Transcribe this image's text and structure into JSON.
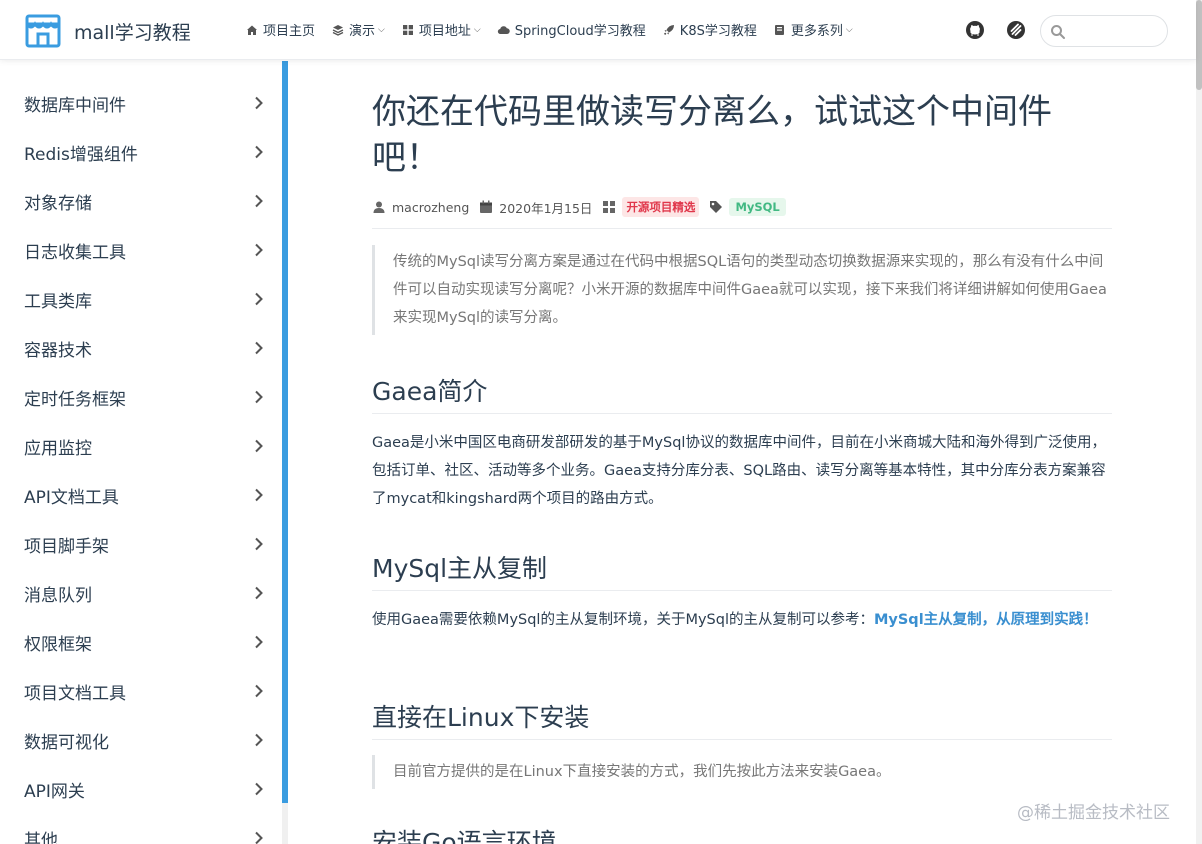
{
  "navbar": {
    "site_name": "mall学习教程",
    "items": [
      {
        "label": "项目主页",
        "icon": "home-icon",
        "caret": false
      },
      {
        "label": "演示",
        "icon": "layers-icon",
        "caret": true
      },
      {
        "label": "项目地址",
        "icon": "grid-icon",
        "caret": true
      },
      {
        "label": "SpringCloud学习教程",
        "icon": "cloud-icon",
        "caret": false
      },
      {
        "label": "K8S学习教程",
        "icon": "rocket-icon",
        "caret": false
      },
      {
        "label": "更多系列",
        "icon": "book-icon",
        "caret": true
      }
    ],
    "search_placeholder": ""
  },
  "sidebar": {
    "items": [
      {
        "label": "数据库中间件"
      },
      {
        "label": "Redis增强组件"
      },
      {
        "label": "对象存储"
      },
      {
        "label": "日志收集工具"
      },
      {
        "label": "工具类库"
      },
      {
        "label": "容器技术"
      },
      {
        "label": "定时任务框架"
      },
      {
        "label": "应用监控"
      },
      {
        "label": "API文档工具"
      },
      {
        "label": "项目脚手架"
      },
      {
        "label": "消息队列"
      },
      {
        "label": "权限框架"
      },
      {
        "label": "项目文档工具"
      },
      {
        "label": "数据可视化"
      },
      {
        "label": "API网关"
      },
      {
        "label": "其他"
      }
    ]
  },
  "article": {
    "title": "你还在代码里做读写分离么，试试这个中间件吧！",
    "author": "macrozheng",
    "date": "2020年1月15日",
    "category": "开源项目精选",
    "tag": "MySQL",
    "intro": "传统的MySql读写分离方案是通过在代码中根据SQL语句的类型动态切换数据源来实现的，那么有没有什么中间件可以自动实现读写分离呢？小米开源的数据库中间件Gaea就可以实现，接下来我们将详细讲解如何使用Gaea来实现MySql的读写分离。",
    "section1_title": "Gaea简介",
    "section1_text": "Gaea是小米中国区电商研发部研发的基于MySql协议的数据库中间件，目前在小米商城大陆和海外得到广泛使用，包括订单、社区、活动等多个业务。Gaea支持分库分表、SQL路由、读写分离等基本特性，其中分库分表方案兼容了mycat和kingshard两个项目的路由方式。",
    "section2_title": "MySql主从复制",
    "section2_text": "使用Gaea需要依赖MySql的主从复制环境，关于MySql的主从复制可以参考：",
    "section2_link": "MySql主从复制，从原理到实践！",
    "section3_title": "直接在Linux下安装",
    "section3_quote": "目前官方提供的是在Linux下直接安装的方式，我们先按此方法来安装Gaea。",
    "section4_title": "安装Go语言环境"
  },
  "watermark": "@稀土掘金技术社区",
  "colors": {
    "accent": "#3a9ce0",
    "text": "#2c3e50",
    "tag_red": "#e0374b",
    "tag_green": "#42b983"
  }
}
